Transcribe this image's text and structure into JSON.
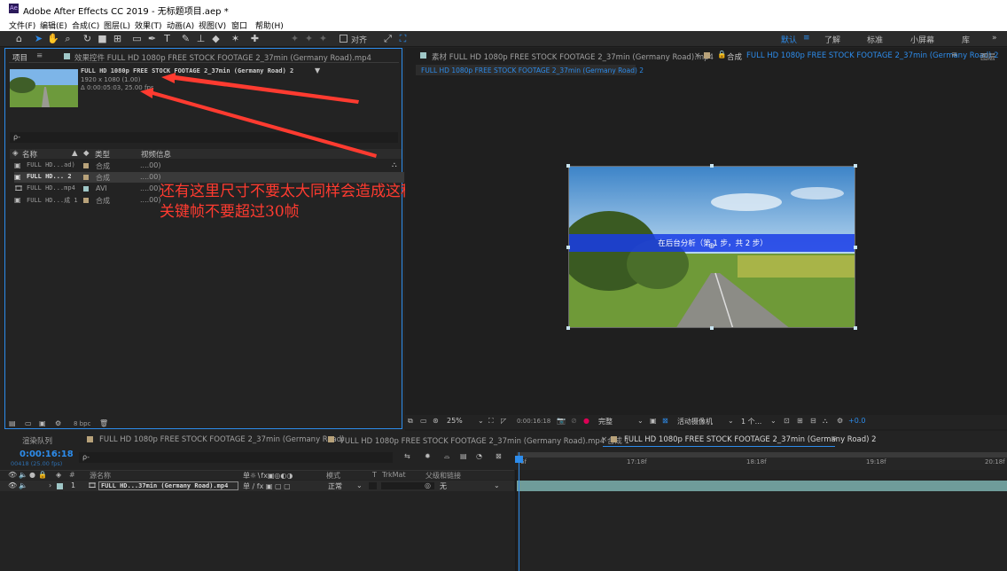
{
  "app": {
    "title": "Adobe After Effects CC 2019 - 无标题项目.aep *",
    "icon_text": "Ae"
  },
  "menu": [
    "文件(F)",
    "编辑(E)",
    "合成(C)",
    "图层(L)",
    "效果(T)",
    "动画(A)",
    "视图(V)",
    "窗口",
    "帮助(H)"
  ],
  "toolbar": {
    "align_label": "对齐",
    "workspaces": [
      "默认",
      "了解",
      "标准",
      "小屏幕",
      "库"
    ]
  },
  "project_panel": {
    "tab_project": "项目",
    "tab_effects": "效果控件 FULL HD 1080p FREE STOCK FOOTAGE 2_37min (Germany Road).mp4",
    "item_name": "FULL HD 1080p FREE STOCK FOOTAGE 2_37min (Germany Road) 2",
    "item_size": "1920 x 1080 (1.00)",
    "item_duration": "Δ 0:00:05:03, 25.00 fps",
    "search_placeholder": "ρ-",
    "col_name": "名称",
    "col_type": "类型",
    "col_video": "视频信息",
    "rows": [
      {
        "name": "FULL HD...ad)",
        "type": "合成",
        "info": "....00)",
        "color": "#b8a27a"
      },
      {
        "name": "FULL HD... 2",
        "type": "合成",
        "info": "....00)",
        "color": "#b8a27a"
      },
      {
        "name": "FULL HD...mp4",
        "type": "AVI",
        "info": "....00)",
        "color": "#9fc7c7"
      },
      {
        "name": "FULL HD...成 1",
        "type": "合成",
        "info": "....00)",
        "color": "#b8a27a"
      }
    ],
    "bpc": "8 bpc"
  },
  "annotation": {
    "line1": "还有这里尺寸不要太大同样会造成这种问题",
    "line2": "关键帧不要超过30帧"
  },
  "viewer": {
    "tab_footage": "素材 FULL HD 1080p FREE STOCK FOOTAGE 2_37min (Germany Road).mp4",
    "tab_comp": "合成",
    "tab_comp_name": "FULL HD 1080p FREE STOCK FOOTAGE 2_37min (Germany Road) 2",
    "tab_layer": "图层",
    "breadcrumb": "FULL HD 1080p FREE STOCK FOOTAGE 2_37min (Germany Road) 2",
    "analysis_text": "在后台分析（第 1 步，共 2 步）",
    "zoom": "25%",
    "timecode": "0:00:16:18",
    "resolution": "完整",
    "camera": "活动摄像机",
    "views": "1 个...",
    "exposure": "+0.0"
  },
  "timeline": {
    "tab_render": "渲染队列",
    "tabs": [
      "FULL HD 1080p FREE STOCK FOOTAGE 2_37min (Germany Road)",
      "FULL HD 1080p FREE STOCK FOOTAGE 2_37min (Germany Road).mp4 合成 1",
      "FULL HD 1080p FREE STOCK FOOTAGE 2_37min (Germany Road) 2"
    ],
    "current_time": "0:00:16:18",
    "frame_info": "00418 (25.00 fps)",
    "col_hash": "#",
    "col_source": "源名称",
    "col_mode": "模式",
    "col_t": "T",
    "col_trkmat": "TrkMat",
    "col_parent": "父级和链接",
    "layer": {
      "index": "1",
      "name": "FULL HD...37min (Germany Road).mp4",
      "mode": "正常",
      "parent": "无"
    },
    "ruler": [
      "6f",
      "17:18f",
      "18:18f",
      "19:18f",
      "20:18f"
    ]
  },
  "colors": {
    "accent": "#2d8ceb",
    "annotation": "#ff3b30",
    "track": "#6f9c9a"
  }
}
